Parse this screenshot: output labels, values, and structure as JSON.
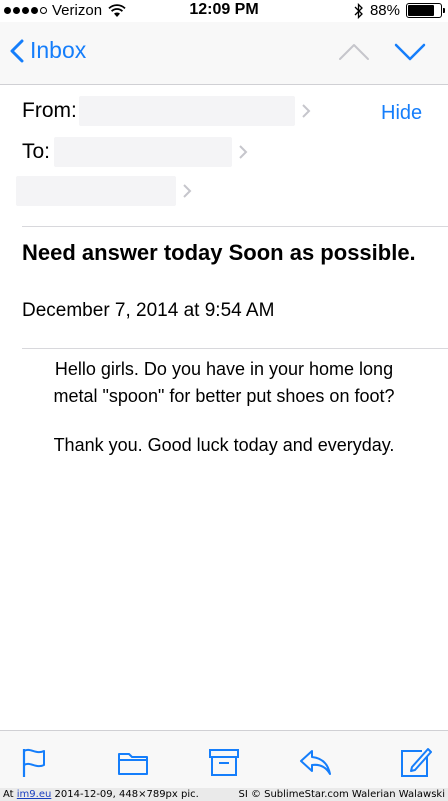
{
  "status_bar": {
    "carrier": "Verizon",
    "time": "12:09 PM",
    "battery": "88%",
    "battery_level": 0.88
  },
  "nav": {
    "back_label": "Inbox"
  },
  "header": {
    "from_label": "From:",
    "to_label": "To:",
    "hide_label": "Hide"
  },
  "message": {
    "subject": "Need answer today Soon as possible.",
    "date": "December 7, 2014 at 9:54 AM",
    "body_line1": "Hello girls. Do you have in your home long",
    "body_line2": "metal \"spoon\" for better put shoes on foot?",
    "body_line3": "Thank you. Good luck today and everyday."
  },
  "toolbar": {
    "icons": [
      "flag-icon",
      "folder-icon",
      "archive-icon",
      "reply-icon",
      "compose-icon"
    ],
    "accent_color": "#157efb"
  },
  "caption": {
    "prefix": "At",
    "site": "im9.eu",
    "info": "2014-12-09, 448×789px pic.",
    "credit": "SI © SublimeStar.com Walerian Walawski"
  }
}
